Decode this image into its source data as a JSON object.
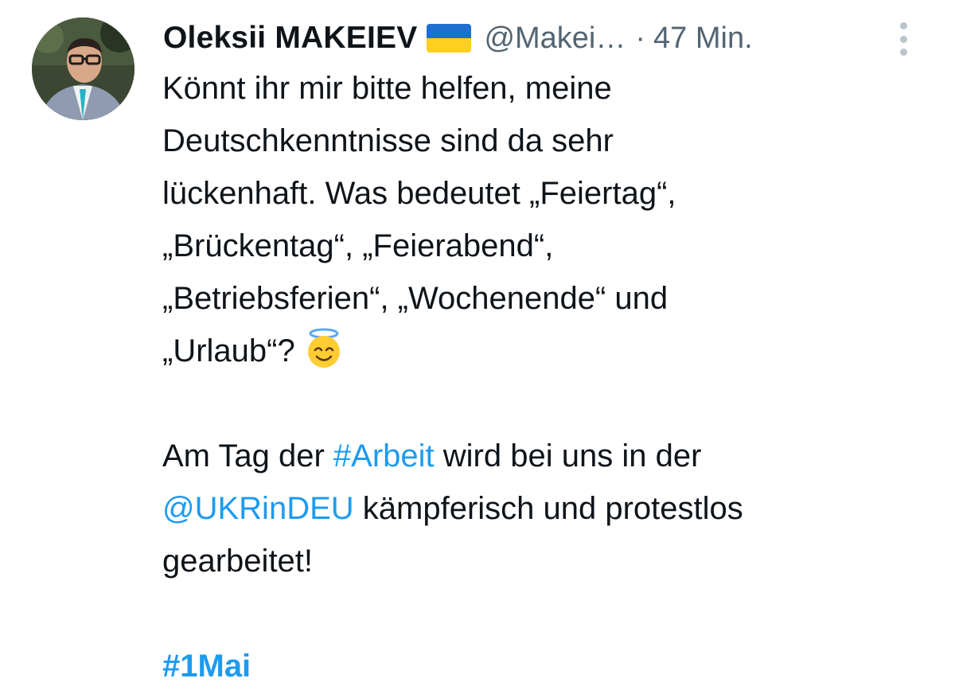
{
  "tweet": {
    "author_name": "Oleksii MAKEIEV",
    "flag_icon": "ukraine-flag-emoji",
    "handle": "@Makei…",
    "separator": "·",
    "time_ago": "47 Min.",
    "emoji_icon": "smiling-face-with-halo-emoji",
    "text_lines": [
      "Könnt ihr mir bitte helfen, meine",
      "Deutschkenntnisse sind da sehr",
      "lückenhaft. Was bedeutet „Feiertag“,",
      "„Brückentag“, „Feierabend“,",
      "„Betriebsferien“, „Wochenende“ und",
      "„Urlaub“?"
    ],
    "paragraph2": {
      "pre": "Am Tag der ",
      "hashtag": "#Arbeit",
      "post": " wird bei uns in der",
      "mention": "@UKRinDEU",
      "post2": " kämpferisch und protestlos",
      "last": "gearbeitet!"
    },
    "hashtag_final": "#1Mai"
  },
  "colors": {
    "text": "#0f1419",
    "secondary": "#536471",
    "link": "#1d9bf0",
    "flag_blue": "#1f6fd1",
    "flag_yellow": "#ffcf1f"
  }
}
